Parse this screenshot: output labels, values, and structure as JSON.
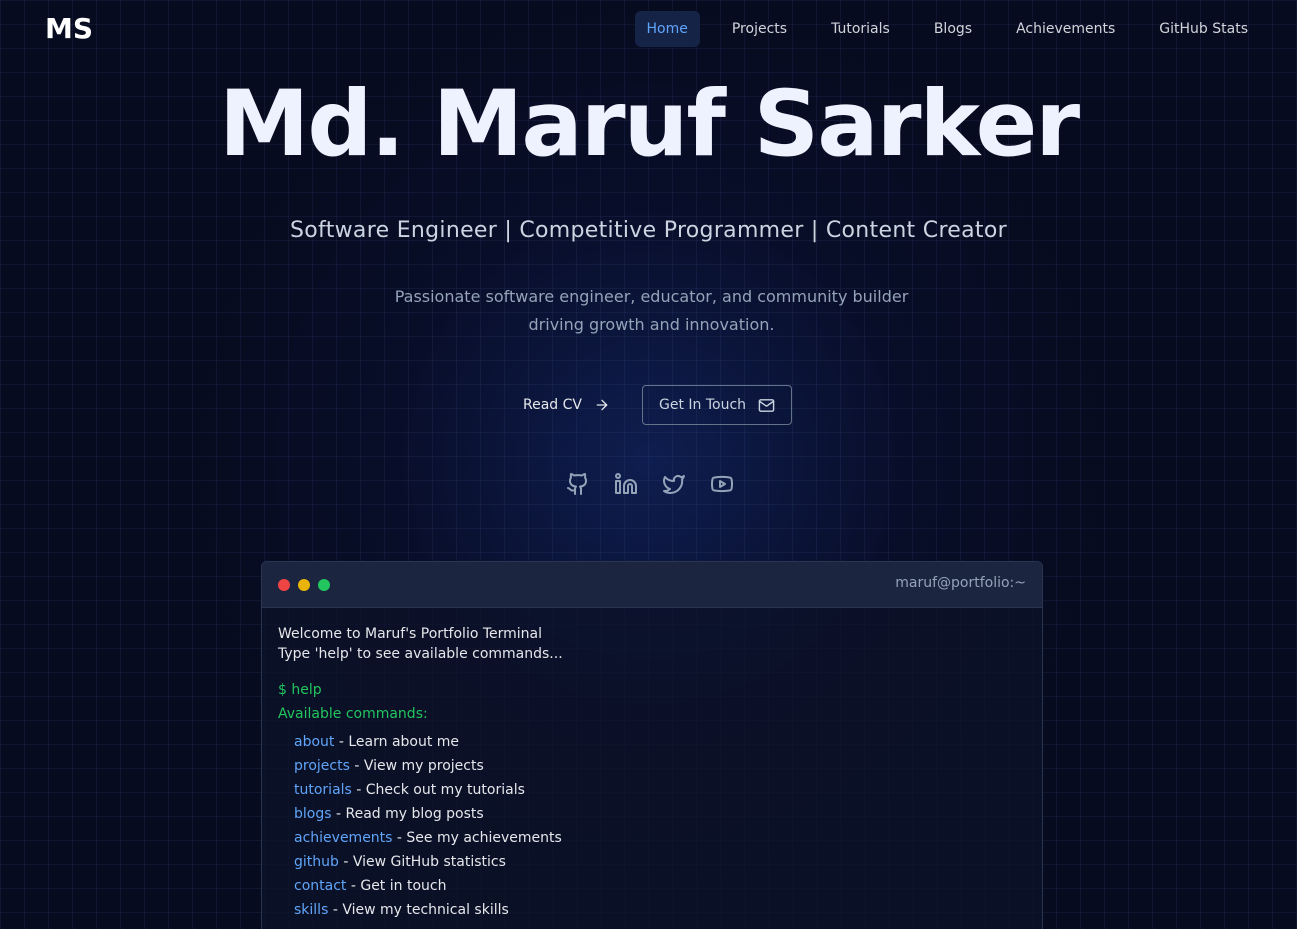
{
  "nav": {
    "logo": "MS",
    "links": [
      "Home",
      "Projects",
      "Tutorials",
      "Blogs",
      "Achievements",
      "GitHub Stats"
    ],
    "active": "Home"
  },
  "hero": {
    "name": "Md. Maruf Sarker",
    "subtitle": "Software Engineer | Competitive Programmer | Content Creator",
    "description": "Passionate software engineer, educator, and community builder driving growth and innovation.",
    "read_cv": "Read CV",
    "get_in_touch": "Get In Touch"
  },
  "socials": [
    "github-icon",
    "linkedin-icon",
    "twitter-icon",
    "youtube-icon"
  ],
  "terminal": {
    "title": "maruf@portfolio:~",
    "welcome": "Welcome to Maruf's Portfolio Terminal",
    "hint": "Type 'help' to see available commands...",
    "prompt": "$ help",
    "available": "Available commands:",
    "commands": [
      {
        "name": "about",
        "desc": " - Learn about me"
      },
      {
        "name": "projects",
        "desc": " - View my projects"
      },
      {
        "name": "tutorials",
        "desc": " - Check out my tutorials"
      },
      {
        "name": "blogs",
        "desc": " - Read my blog posts"
      },
      {
        "name": "achievements",
        "desc": " - See my achievements"
      },
      {
        "name": "github",
        "desc": " - View GitHub statistics"
      },
      {
        "name": "contact",
        "desc": " - Get in touch"
      },
      {
        "name": "skills",
        "desc": " - View my technical skills"
      }
    ]
  },
  "colors": {
    "background": "#070b1f",
    "accent": "#60a5fa",
    "terminal_green": "#22c55e"
  }
}
